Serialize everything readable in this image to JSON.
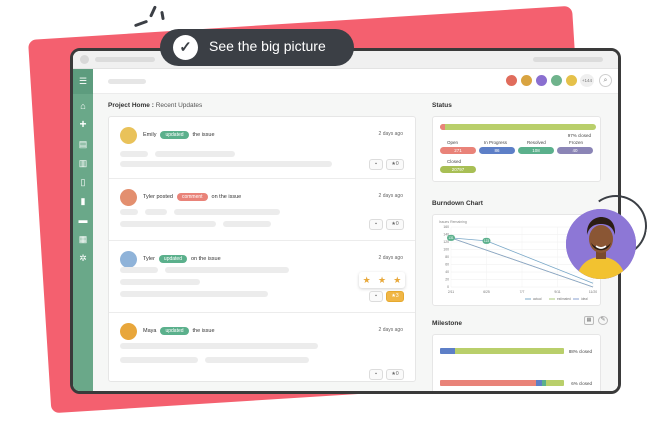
{
  "headline": {
    "text": "See  the big picture",
    "check_icon": "check-icon"
  },
  "header": {
    "team_avatars": [
      {
        "color": "#e06c5c"
      },
      {
        "color": "#d9a441"
      },
      {
        "color": "#8a6fd0"
      },
      {
        "color": "#6fb38c"
      },
      {
        "color": "#e5c14a"
      }
    ],
    "more_count": "+144",
    "search_icon": "search-icon"
  },
  "sidebar": {
    "items": [
      "menu-icon",
      "home-icon",
      "plus-icon",
      "list-icon",
      "board-icon",
      "file-icon",
      "doc-icon",
      "folder-icon",
      "archive-icon",
      "gear-icon"
    ]
  },
  "feed": {
    "title": "Project Home :",
    "subtitle": "Recent Updates",
    "items": [
      {
        "user": "Emily",
        "action": "updated",
        "suffix": "the issue",
        "time": "2 days ago",
        "badge_color": "green",
        "comment_count": "0"
      },
      {
        "user": "Tyler posted",
        "action": "comment",
        "suffix": "on the issue",
        "time": "2 days ago",
        "badge_color": "red",
        "comment_count": "0"
      },
      {
        "user": "Tyler",
        "action": "updated",
        "suffix": "on the issue",
        "time": "2 days ago",
        "badge_color": "green",
        "comment_count": "3"
      },
      {
        "user": "Maya",
        "action": "updated",
        "suffix": "the issue",
        "time": "2 days ago",
        "badge_color": "green",
        "comment_count": "0"
      }
    ]
  },
  "status": {
    "title": "Status",
    "closed_pct_label": "97% closed",
    "closed_fraction": 0.97,
    "counts": [
      {
        "label": "Open",
        "value": "271",
        "color": "#e98379"
      },
      {
        "label": "In Progress",
        "value": "86",
        "color": "#5d7fc7"
      },
      {
        "label": "Resolved",
        "value": "108",
        "color": "#5bb08c"
      },
      {
        "label": "Frozen",
        "value": "40",
        "color": "#8b85b6"
      },
      {
        "label": "Closed",
        "value": "20797",
        "color": "#a8bf55"
      }
    ]
  },
  "burndown": {
    "title": "Burndown Chart"
  },
  "chart_data": {
    "type": "line",
    "title": "Issues Remaining",
    "x": [
      "2/11",
      "6/25",
      "7/7",
      "9/11",
      "11/20"
    ],
    "y_ticks": [
      0,
      20,
      40,
      60,
      80,
      100,
      120,
      140,
      160
    ],
    "ylim": [
      0,
      160
    ],
    "series": [
      {
        "name": "actual",
        "points": [
          [
            0,
            131
          ],
          [
            1,
            123
          ],
          [
            4,
            10
          ]
        ],
        "point_labels": [
          "131",
          "123",
          ""
        ],
        "color": "#7aa8c8"
      },
      {
        "name": "estimated",
        "points": [
          [
            0,
            131
          ],
          [
            4,
            0
          ]
        ],
        "color": "#a8c978"
      },
      {
        "name": "ideal",
        "points": [
          [
            0,
            131
          ],
          [
            4,
            0
          ]
        ],
        "color": "#8aa2d0"
      }
    ],
    "legend": [
      "actual",
      "estimated",
      "ideal"
    ],
    "grid": true
  },
  "milestone": {
    "title": "Milestone",
    "items": [
      {
        "label": "88% closed",
        "fraction": 0.88,
        "open_color": "#5d7fc7",
        "closed_color": "#b9cf6b"
      },
      {
        "label": "6% closed",
        "fraction": 0.06,
        "open_color": "#e98379",
        "closed_color": "#b9cf6b"
      }
    ]
  }
}
